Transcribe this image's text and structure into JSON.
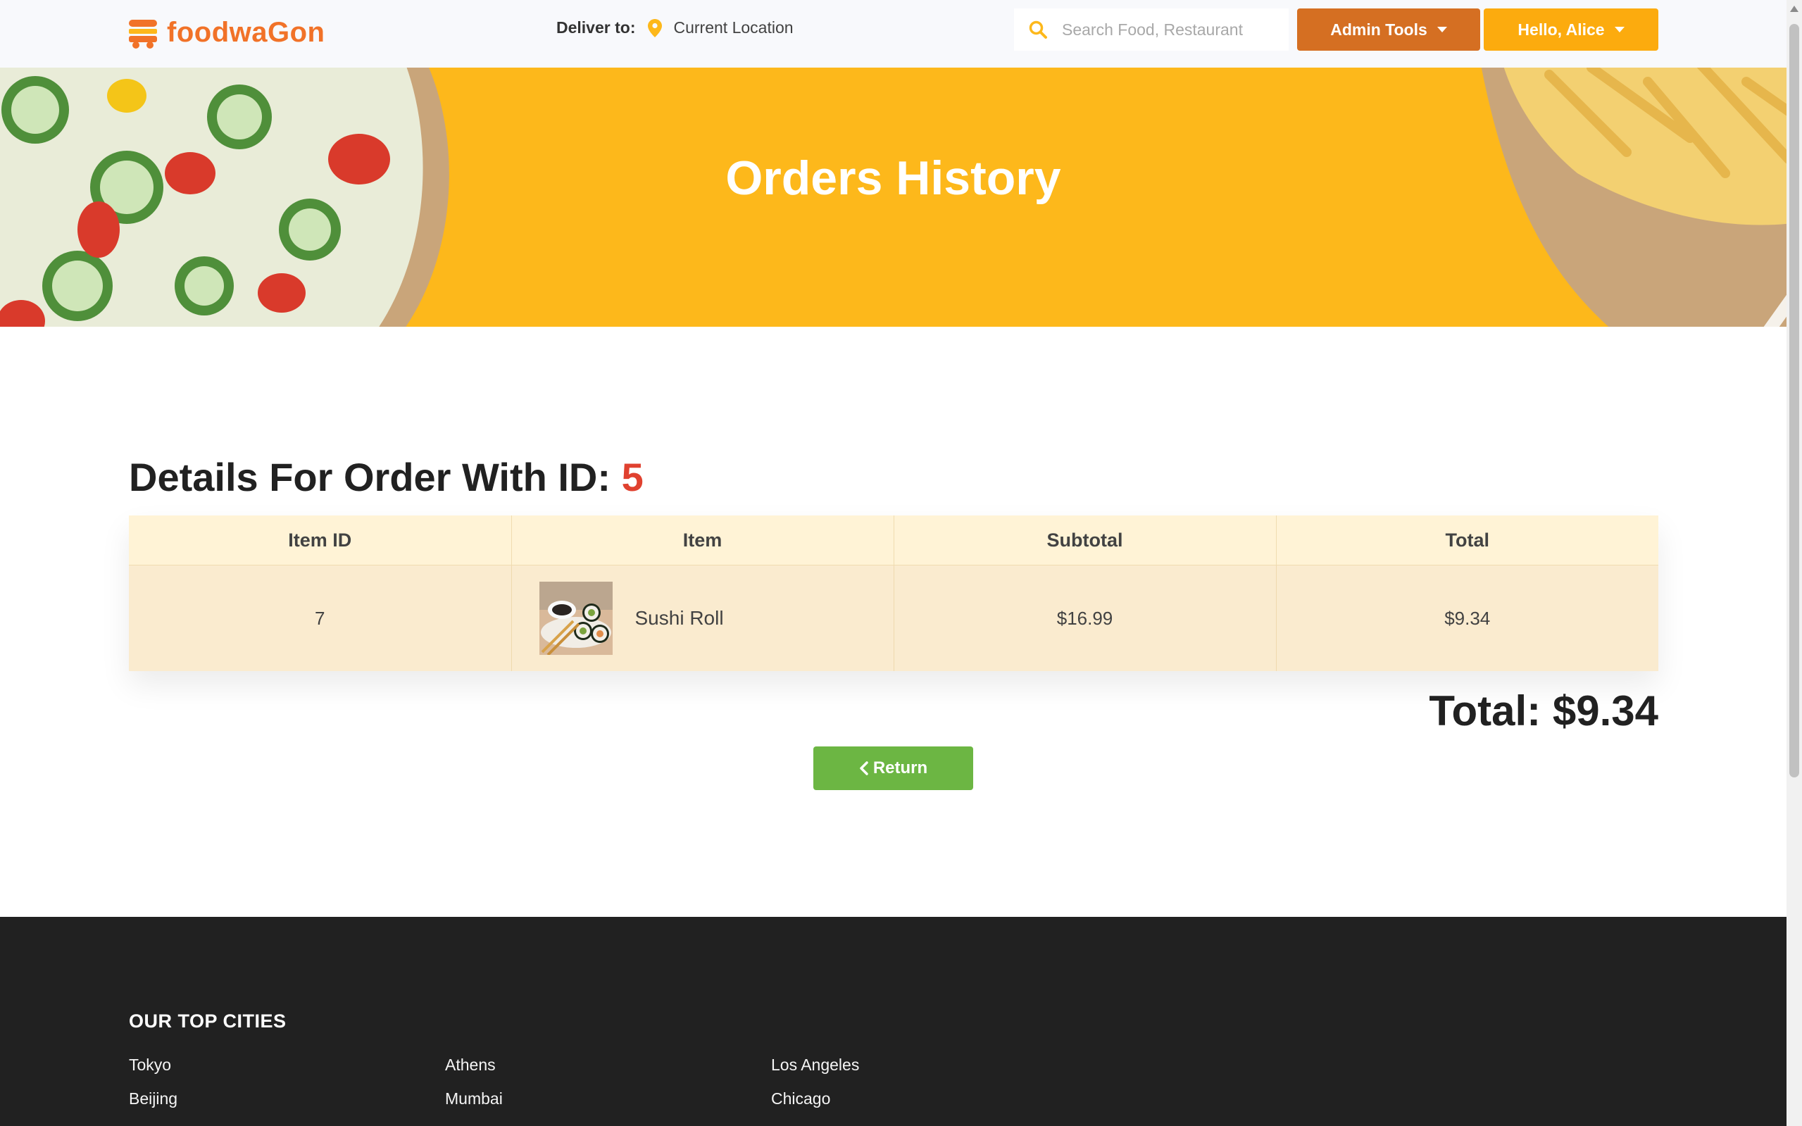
{
  "brand": {
    "name": "foodwaGon",
    "accent_color": "#f17228"
  },
  "navbar": {
    "deliver_label": "Deliver to:",
    "deliver_location": "Current Location",
    "search_placeholder": "Search Food, Restaurant",
    "admin_button": "Admin Tools",
    "user_button": "Hello, Alice"
  },
  "hero": {
    "title": "Orders History",
    "background_color": "#fdb81b"
  },
  "order": {
    "heading_prefix": "Details For Order With ID:",
    "id": "5",
    "columns": [
      "Item ID",
      "Item",
      "Subtotal",
      "Total"
    ],
    "rows": [
      {
        "item_id": "7",
        "item_name": "Sushi Roll",
        "subtotal": "$16.99",
        "total": "$9.34"
      }
    ],
    "grand_total_label": "Total:",
    "grand_total_value": "$9.34",
    "return_button": "Return"
  },
  "footer": {
    "title": "OUR TOP CITIES",
    "cities": [
      "Tokyo",
      "Athens",
      "Los Angeles",
      "Beijing",
      "Mumbai",
      "Chicago"
    ]
  },
  "icons": {
    "brand": "food-truck-icon",
    "location": "map-pin-icon",
    "search": "search-icon",
    "return": "chevron-left-icon"
  }
}
